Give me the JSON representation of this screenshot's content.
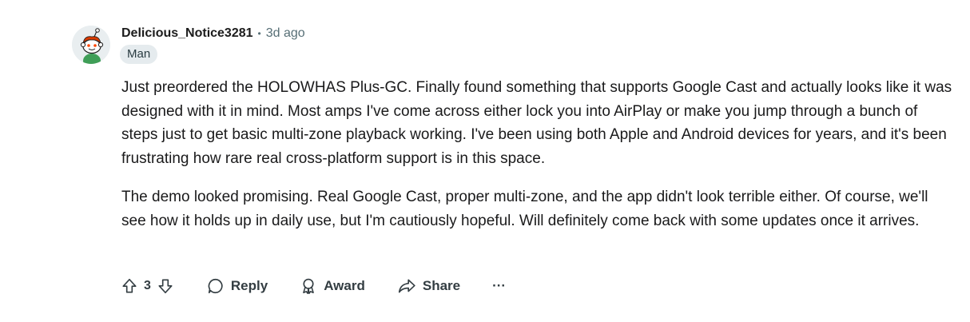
{
  "comment": {
    "username": "Delicious_Notice3281",
    "separator": "•",
    "timestamp": "3d ago",
    "flair": "Man",
    "paragraphs": [
      "Just preordered the HOLOWHAS Plus-GC. Finally found something that supports Google Cast and actually looks like it was designed with it in mind. Most amps I've come across either lock you into AirPlay or make you jump through a bunch of steps just to get basic multi-zone playback working. I've been using both Apple and Android devices for years, and it's been frustrating how rare real cross-platform support is in this space.",
      "The demo looked promising. Real Google Cast, proper multi-zone, and the app didn't look terrible either. Of course, we'll see how it holds up in daily use, but I'm cautiously hopeful. Will definitely come back with some updates once it arrives."
    ]
  },
  "actions": {
    "score": "3",
    "reply_label": "Reply",
    "award_label": "Award",
    "share_label": "Share",
    "more_label": "···"
  },
  "icons": {
    "upvote": "upvote-icon",
    "downvote": "downvote-icon",
    "reply": "speech-bubble-icon",
    "award": "award-ribbon-icon",
    "share": "share-arrow-icon",
    "more": "ellipsis-icon"
  },
  "colors": {
    "text": "#1a1a1b",
    "muted": "#576f76",
    "flair_bg": "#e5ebee",
    "action_text": "#333d42"
  }
}
